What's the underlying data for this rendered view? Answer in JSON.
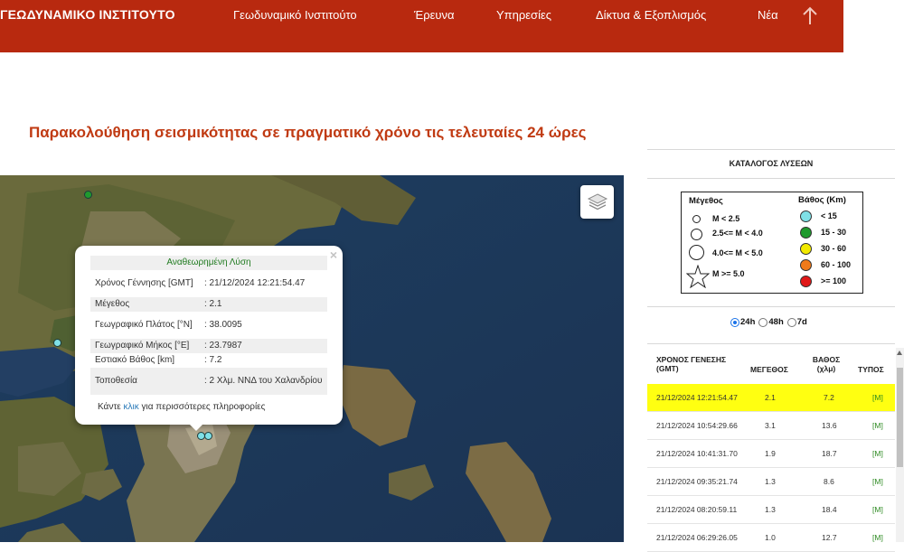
{
  "header": {
    "brand": "ΓΕΩΔΥΝΑΜΙΚΟ ΙΝΣΤΙΤΟΥΤΟ",
    "nav": [
      "Γεωδυναμικό Ινστιτούτο",
      "Έρευνα",
      "Υπηρεσίες",
      "Δίκτυα & Εξοπλισμός",
      "Νέα"
    ],
    "background_color": "#b8290f"
  },
  "page_title": "Παρακολούθηση σεισμικότητας σε πραγματικό χρόνο τις τελευταίες 24 ώρες",
  "map": {
    "popup": {
      "heading": "Αναθεωρημένη Λύση",
      "rows": [
        {
          "label": "Χρόνος Γέννησης [GMT]",
          "value": ": 21/12/2024 12:21:54.47"
        },
        {
          "label": "Μέγεθος",
          "value": ": 2.1"
        },
        {
          "label": "Γεωγραφικό Πλάτος [°N]",
          "value": ": 38.0095"
        },
        {
          "label": "Γεωγραφικό Μήκος [°E]",
          "value": ": 23.7987"
        },
        {
          "label": "Εστιακό Βάθος [km]",
          "value": ": 7.2"
        },
        {
          "label": "Τοποθεσία",
          "value": ": 2 Χλμ. ΝΝΔ του Χαλανδρίου"
        }
      ],
      "footer_before": "Κάντε ",
      "footer_link": "κλικ",
      "footer_after": " για περισσότερες πληροφορίες",
      "close_symbol": "×"
    },
    "layers_icon": "layers-icon"
  },
  "panel": {
    "catalog_title": "ΚΑΤΑΛΟΓΟΣ ΛΥΣΕΩΝ",
    "legend": {
      "magnitude_title": "Μέγεθος",
      "depth_title": "Βάθος (Km)",
      "magnitude_classes": [
        "M < 2.5",
        "2.5<= M < 4.0",
        "4.0<= M < 5.0",
        "M >= 5.0"
      ],
      "depth_classes": [
        {
          "label": "< 15",
          "color": "#7fe0e6"
        },
        {
          "label": "15 - 30",
          "color": "#1f9a2e"
        },
        {
          "label": "30 - 60",
          "color": "#f2ea00"
        },
        {
          "label": "60 - 100",
          "color": "#f07a1a"
        },
        {
          "label": ">= 100",
          "color": "#e01818"
        }
      ]
    },
    "time_filter": {
      "options": [
        "24h",
        "48h",
        "7d"
      ],
      "selected": "24h"
    },
    "table": {
      "headers": {
        "time": "ΧΡΟΝΟΣ ΓΕΝΕΣΗΣ (GMT)",
        "magnitude": "ΜΕΓΕΘΟΣ",
        "depth": "ΒΑΘΟΣ (χλμ)",
        "type": "ΤΥΠΟΣ"
      },
      "rows": [
        {
          "time": "21/12/2024 12:21:54.47",
          "magnitude": "2.1",
          "depth": "7.2",
          "type": "[M]",
          "highlighted": true
        },
        {
          "time": "21/12/2024 10:54:29.66",
          "magnitude": "3.1",
          "depth": "13.6",
          "type": "[M]"
        },
        {
          "time": "21/12/2024 10:41:31.70",
          "magnitude": "1.9",
          "depth": "18.7",
          "type": "[M]"
        },
        {
          "time": "21/12/2024 09:35:21.74",
          "magnitude": "1.3",
          "depth": "8.6",
          "type": "[M]"
        },
        {
          "time": "21/12/2024 08:20:59.11",
          "magnitude": "1.3",
          "depth": "18.4",
          "type": "[M]"
        },
        {
          "time": "21/12/2024 06:29:26.05",
          "magnitude": "1.0",
          "depth": "12.7",
          "type": "[M]"
        }
      ],
      "highlight_color": "#ffff11",
      "type_color": "#2e8b22"
    }
  }
}
